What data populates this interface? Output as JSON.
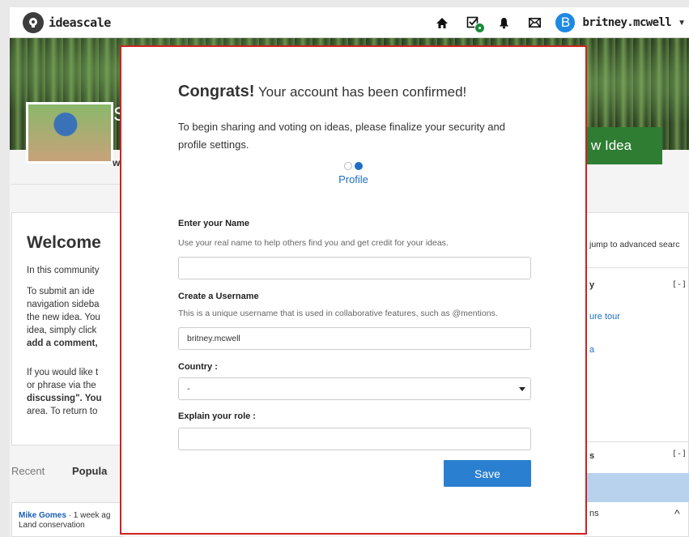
{
  "header": {
    "app_name": "ideascale",
    "username": "britney.mcwell",
    "avatar_initial": "B",
    "icons": [
      "home-icon",
      "tasks-icon",
      "bell-icon",
      "mail-icon"
    ]
  },
  "background": {
    "banner_letter": "S",
    "submit_button": "w Idea",
    "strip_letter": "w",
    "welcome_title": "Welcome",
    "paragraphs": [
      [
        "In this community"
      ],
      [
        "To submit an ide",
        "navigation sideba",
        "the new idea. You",
        "idea, simply click",
        "add a comment,"
      ],
      [
        "If you would like t",
        "or phrase via the",
        "discussing\". You",
        "area. To return to"
      ]
    ],
    "tabs": {
      "recent": "Recent",
      "popular": "Popula"
    },
    "feed": {
      "author": "Mike Gomes",
      "meta": " · 1 week ag",
      "title": "Land conservation"
    },
    "right": {
      "search_link": "jump to advanced searc",
      "section1_letter": "y",
      "toggle": "[-]",
      "tour_link": "ure tour",
      "link_a": "a",
      "section2_letter": "s",
      "section3_letter": "ns",
      "chevron": "^"
    }
  },
  "modal": {
    "title_bold": "Congrats!",
    "title_rest": " Your account has been confirmed!",
    "intro": "To begin sharing and voting on ideas, please finalize your security and profile settings.",
    "step_label": "Profile",
    "steps_total": 2,
    "current_step": 2,
    "name_label": "Enter your Name",
    "name_help": "Use your real name to help others find you and get credit for your ideas.",
    "name_value": "",
    "username_label": "Create a Username",
    "username_help": "This is a unique username that is used in collaborative features, such as @mentions.",
    "username_value": "britney.mcwell",
    "country_label": "Country :",
    "country_value": "-",
    "role_label": "Explain your role :",
    "role_value": "",
    "save_label": "Save"
  }
}
